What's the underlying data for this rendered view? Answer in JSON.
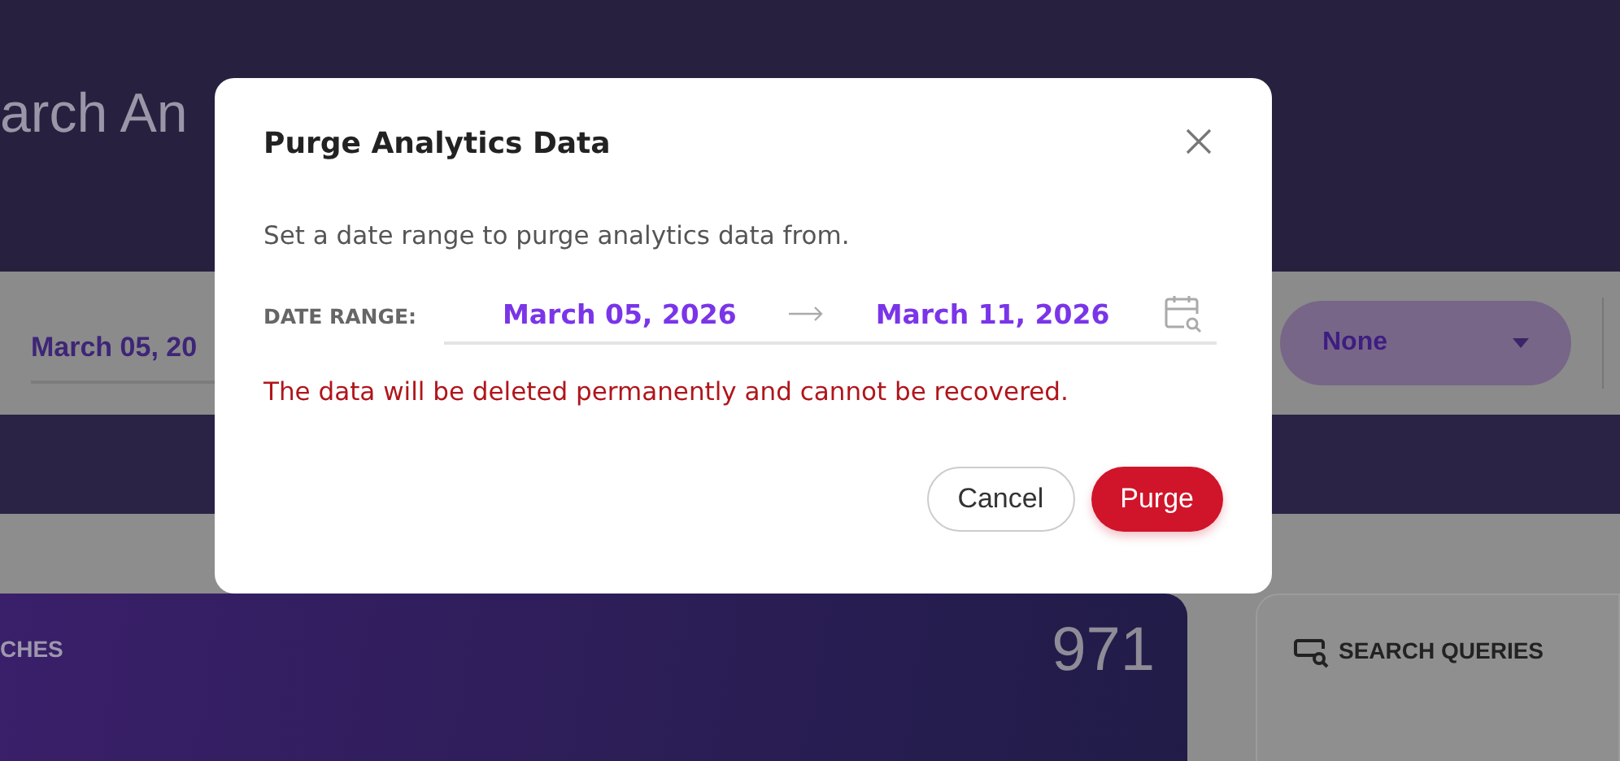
{
  "page": {
    "title": "arch An"
  },
  "filters": {
    "date": "March 05, 20",
    "dropdown": {
      "value": "None"
    }
  },
  "cards": [
    {
      "kind": "gradient",
      "label": "CHES",
      "value": "971"
    },
    {
      "kind": "plain",
      "label": "SEARCH QUERIES"
    }
  ],
  "dialog": {
    "title": "Purge Analytics Data",
    "description": "Set a date range to purge analytics data from.",
    "date_range": {
      "label": "DATE RANGE:",
      "start": "March 05, 2026",
      "end": "March 11, 2026"
    },
    "warning": "The data will be deleted permanently and cannot be recovered.",
    "buttons": [
      {
        "label": "Cancel",
        "kind": "secondary"
      },
      {
        "label": "Purge",
        "kind": "danger"
      }
    ]
  }
}
